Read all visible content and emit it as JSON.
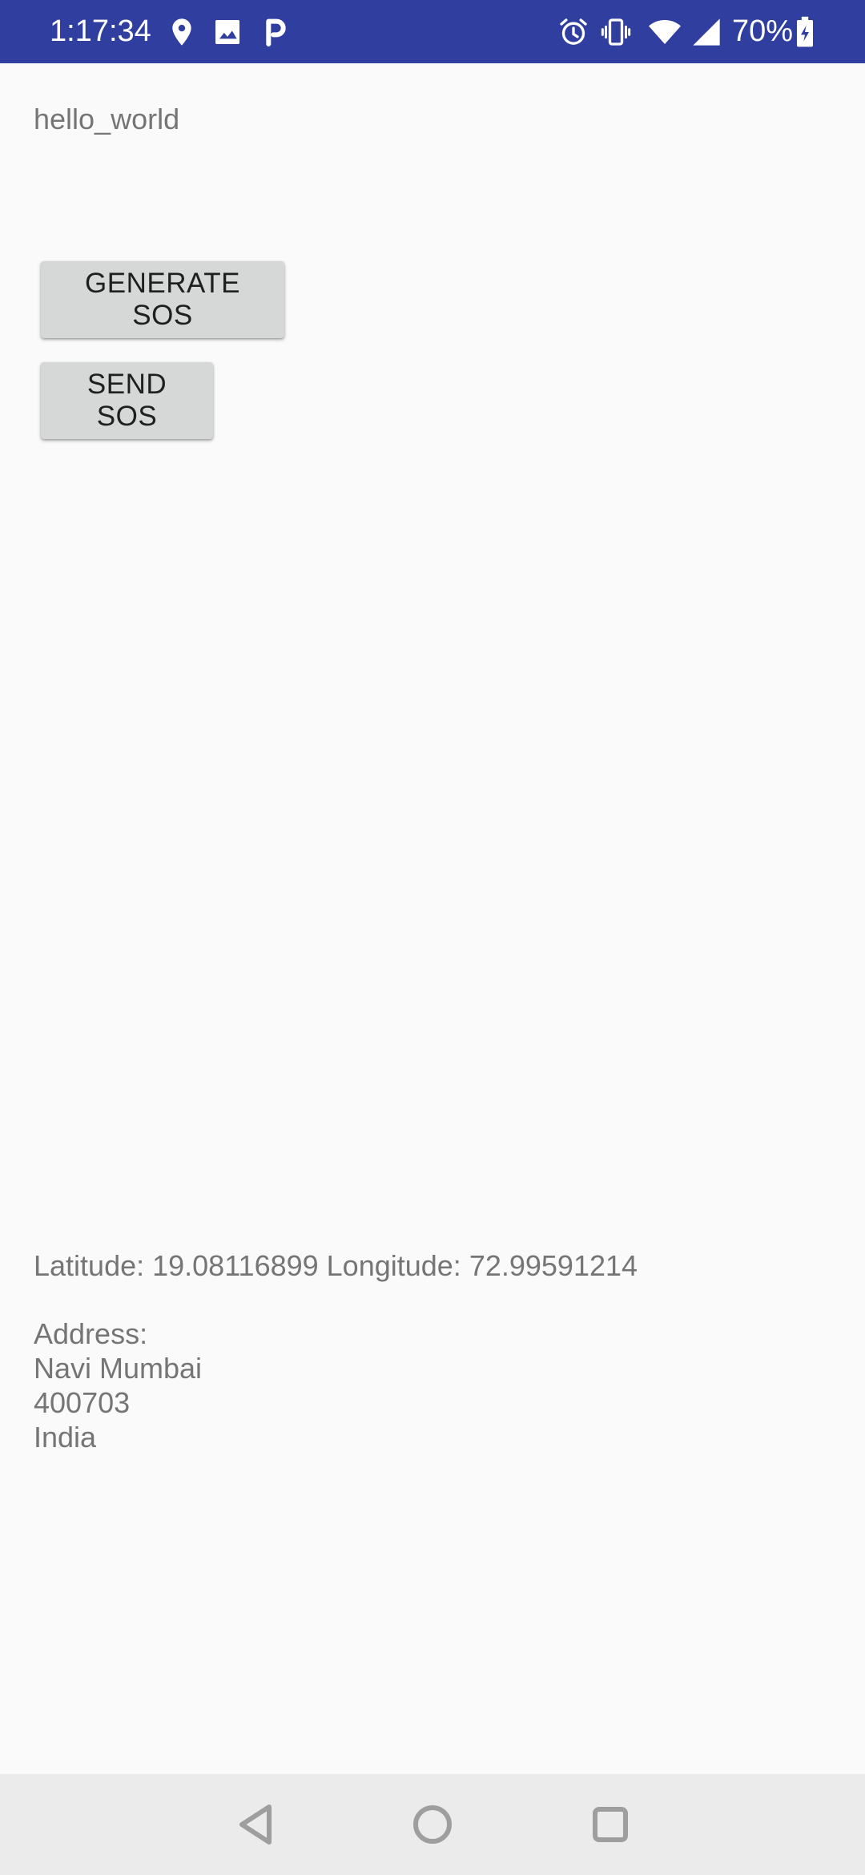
{
  "status_bar": {
    "time": "1:17:34",
    "battery_percent": "70%",
    "background_color": "#303f9f",
    "icons": [
      "location-icon",
      "image-icon",
      "p-app-icon",
      "alarm-icon",
      "vibrate-icon",
      "wifi-icon",
      "signal-icon",
      "battery-icon"
    ]
  },
  "main": {
    "hello_text": "hello_world",
    "generate_button_label": "GENERATE SOS",
    "send_button_label": "SEND SOS",
    "location_text": "Latitude: 19.08116899 Longitude: 72.99591214",
    "address_label": "Address:",
    "address_lines": [
      "Navi Mumbai",
      "400703",
      "India"
    ]
  },
  "nav_bar": {
    "icons": [
      "back-icon",
      "home-icon",
      "recents-icon"
    ]
  }
}
